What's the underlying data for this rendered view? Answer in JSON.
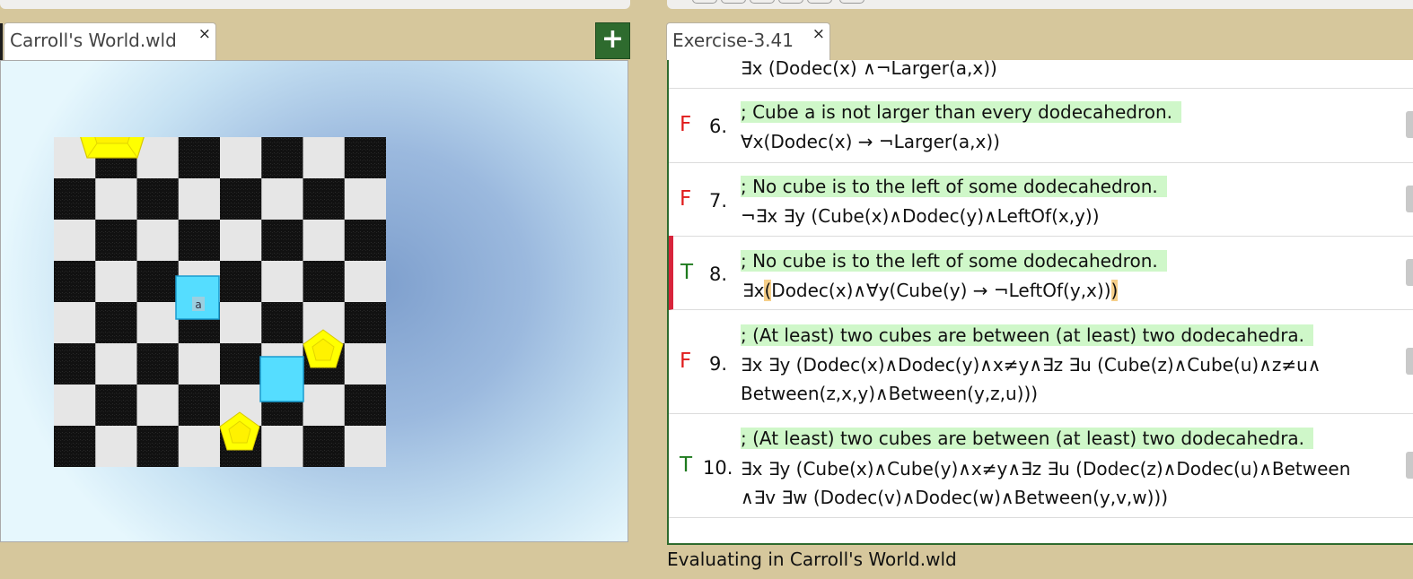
{
  "left_tab": {
    "title": "Carroll's World.wld",
    "close": "×"
  },
  "add_button": {
    "label": "+"
  },
  "right_tab": {
    "title": "Exercise-3.41",
    "close": "×"
  },
  "world": {
    "cube_label": "a"
  },
  "sentences": [
    {
      "value": "",
      "number": "",
      "comment": "",
      "formula": [
        "∃x (Dodec(x) ∧¬Larger(a,x))"
      ]
    },
    {
      "value": "F",
      "number": "6.",
      "comment": "; Cube a is not larger than every dodecahedron.",
      "formula": [
        "∀x(Dodec(x) → ¬Larger(a,x))"
      ]
    },
    {
      "value": "F",
      "number": "7.",
      "comment": "; No cube is to the left of some dodecahedron.",
      "formula": [
        "¬∃x ∃y (Cube(x)∧Dodec(y)∧LeftOf(x,y))"
      ]
    },
    {
      "value": "T",
      "number": "8.",
      "comment": "; No cube is to the left of some dodecahedron.",
      "formula_parts": [
        "∃x",
        "(",
        "Dodec(x)∧∀y(Cube(y) → ¬LeftOf(y,x))",
        ")"
      ],
      "selected": true
    },
    {
      "value": "F",
      "number": "9.",
      "comment": "; (At least) two cubes are between (at least) two dodecahedra.",
      "formula": [
        "∃x ∃y (Dodec(x)∧Dodec(y)∧x≠y∧∃z ∃u (Cube(z)∧Cube(u)∧z≠u∧",
        "Between(z,x,y)∧Between(y,z,u)))"
      ]
    },
    {
      "value": "T",
      "number": "10.",
      "comment": "; (At least) two cubes are between (at least) two dodecahedra.",
      "formula": [
        "∃x ∃y (Cube(x)∧Cube(y)∧x≠y∧∃z ∃u (Dodec(z)∧Dodec(u)∧Between",
        "∧∃v ∃w (Dodec(v)∧Dodec(w)∧Between(y,v,w)))"
      ]
    }
  ],
  "status": "Evaluating in Carroll's World.wld",
  "colors": {
    "background": "#d6c79c",
    "accent_green": "#2e6b2e",
    "false_red": "#e01b1b",
    "true_green": "#1e7a1e",
    "comment_bg": "#cff7c9",
    "dodec_yellow": "#ffff00",
    "cube_cyan": "#55ddff"
  }
}
